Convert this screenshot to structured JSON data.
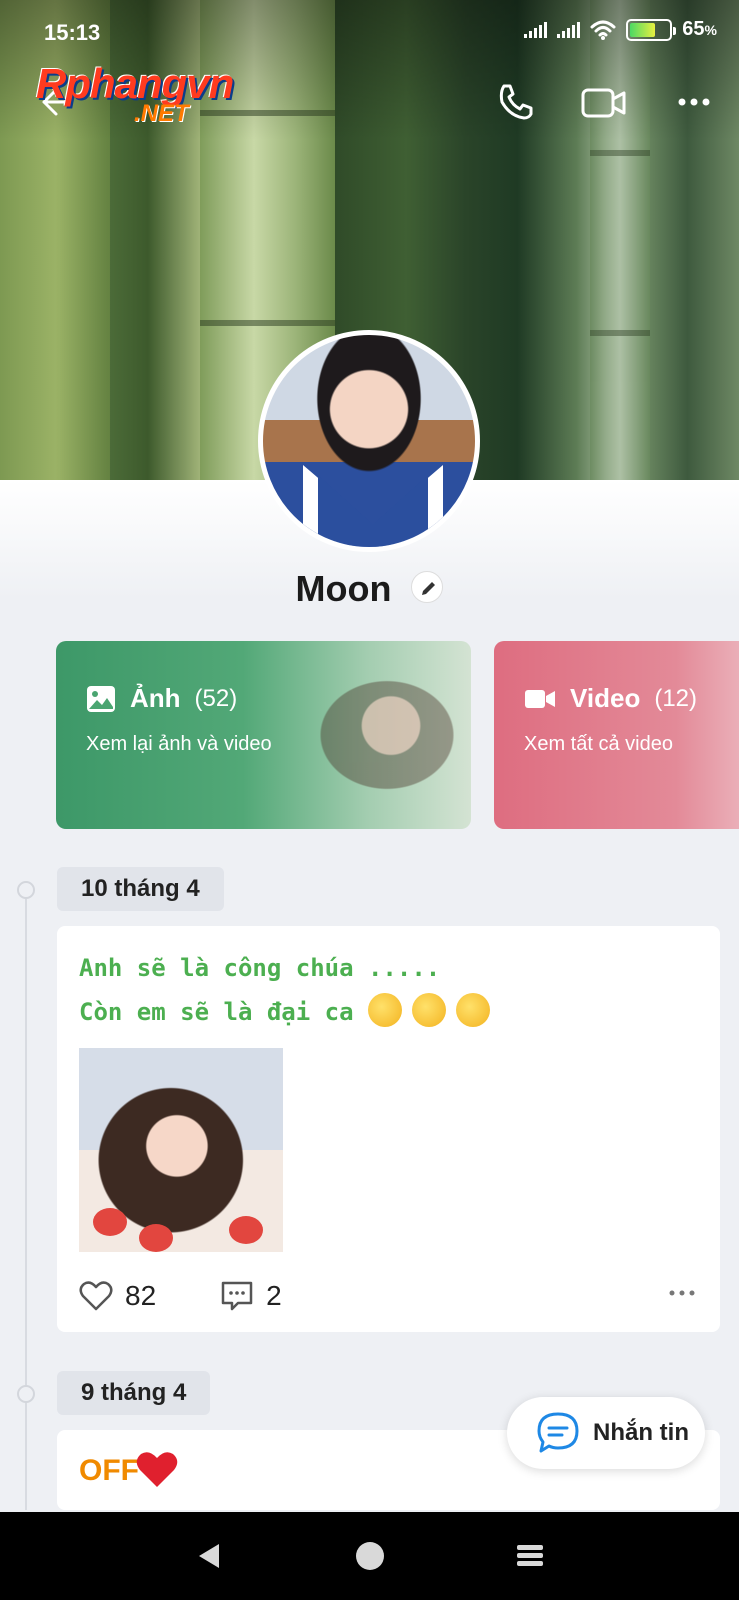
{
  "status_bar": {
    "time": "15:13",
    "battery_percent": "65",
    "battery_suffix": "%"
  },
  "watermark": {
    "line1": "Rphangvn",
    "line2": ".NET"
  },
  "profile": {
    "name": "Moon"
  },
  "media_cards": [
    {
      "title": "Ảnh",
      "count": "(52)",
      "subtitle": "Xem lại ảnh và video",
      "color": "#3d9868"
    },
    {
      "title": "Video",
      "count": "(12)",
      "subtitle": "Xem tất cả video",
      "color": "#de6d80"
    }
  ],
  "timeline": [
    {
      "date": "10 tháng 4",
      "text_line1": "Anh sẽ là công chúa .....",
      "text_line2": "Còn em sẽ là đại ca",
      "emoji": "yawning-face-icon",
      "likes": "82",
      "comments": "2"
    },
    {
      "date": "9 tháng 4",
      "text": "OFF"
    }
  ],
  "fab": {
    "label": "Nhắn tin"
  },
  "colors": {
    "post_text": "#4caf50",
    "fab_icon": "#1e88e5"
  }
}
